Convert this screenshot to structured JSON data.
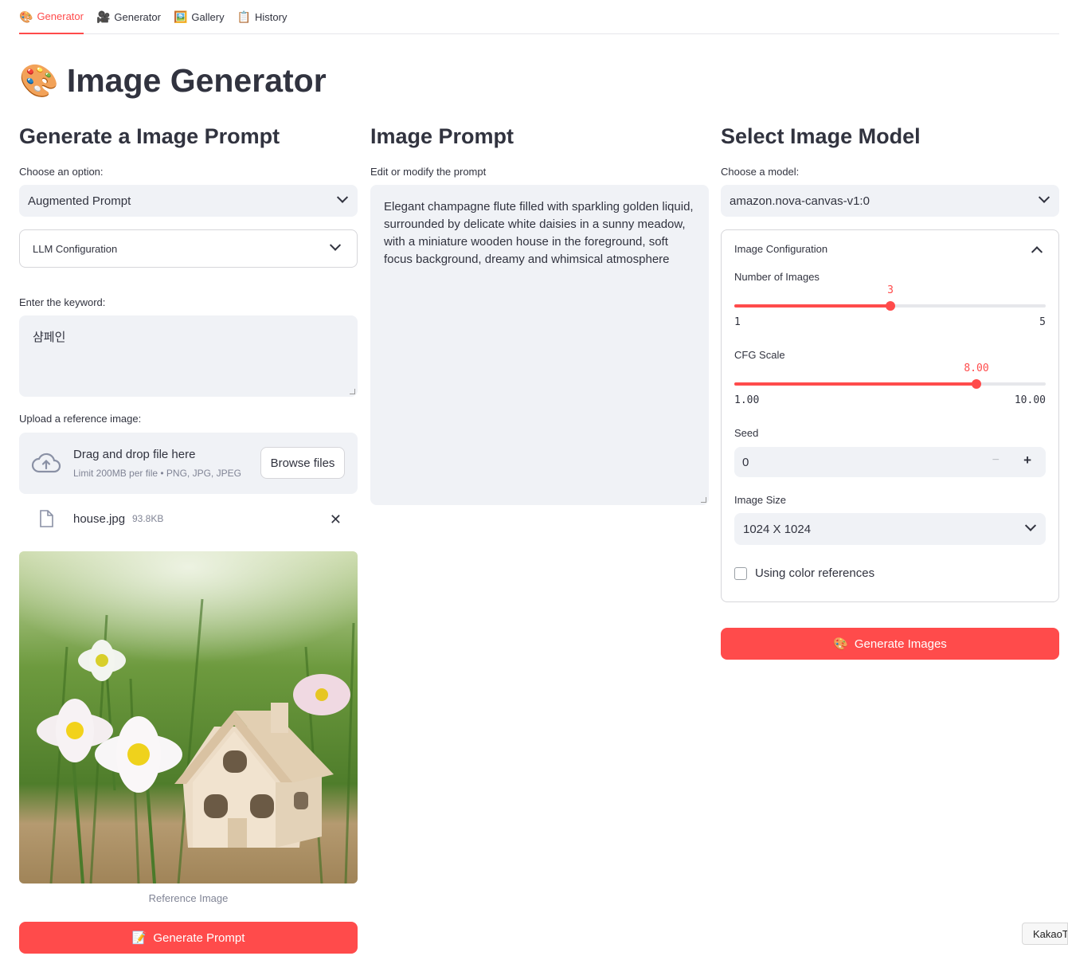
{
  "tabs": [
    {
      "icon": "🎨",
      "label": "Generator"
    },
    {
      "icon": "🎥",
      "label": "Generator"
    },
    {
      "icon": "🖼️",
      "label": "Gallery"
    },
    {
      "icon": "📋",
      "label": "History"
    }
  ],
  "page": {
    "title_icon": "🎨",
    "title": "Image Generator"
  },
  "left": {
    "heading": "Generate a Image Prompt",
    "option_label": "Choose an option:",
    "option_value": "Augmented Prompt",
    "llm_config_label": "LLM Configuration",
    "keyword_label": "Enter the keyword:",
    "keyword_value": "샴페인",
    "upload_label": "Upload a reference image:",
    "drag_text": "Drag and drop file here",
    "limit_text": "Limit 200MB per file • PNG, JPG, JPEG",
    "browse_label": "Browse files",
    "file_name": "house.jpg",
    "file_size": "93.8KB",
    "image_caption": "Reference Image",
    "generate_icon": "📝",
    "generate_label": "Generate Prompt"
  },
  "middle": {
    "heading": "Image Prompt",
    "prompt_label": "Edit or modify the prompt",
    "prompt_value": "Elegant champagne flute filled with sparkling golden liquid, surrounded by delicate white daisies in a sunny meadow, with a miniature wooden house in the foreground, soft focus background, dreamy and whimsical atmosphere"
  },
  "right": {
    "heading": "Select Image Model",
    "model_label": "Choose a model:",
    "model_value": "amazon.nova-canvas-v1:0",
    "config_label": "Image Configuration",
    "num_images": {
      "label": "Number of Images",
      "value": "3",
      "min": "1",
      "max": "5",
      "fraction": 0.5
    },
    "cfg_scale": {
      "label": "CFG Scale",
      "value": "8.00",
      "min": "1.00",
      "max": "10.00",
      "fraction": 0.7778
    },
    "seed": {
      "label": "Seed",
      "value": "0",
      "minus": "−",
      "plus": "+"
    },
    "image_size": {
      "label": "Image Size",
      "value": "1024 X 1024"
    },
    "color_ref_label": "Using color references",
    "color_ref_checked": false,
    "generate_icon": "🎨",
    "generate_label": "Generate Images"
  },
  "overlay": {
    "kakao_label": "KakaoT"
  },
  "colors": {
    "accent": "#ff4b4b",
    "input_bg": "#f0f2f6",
    "text": "#31333f",
    "muted": "#808495"
  }
}
